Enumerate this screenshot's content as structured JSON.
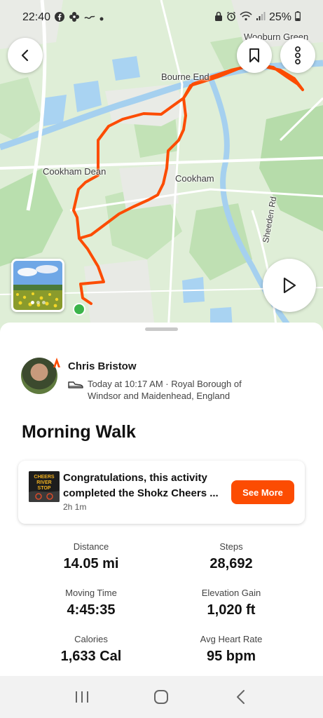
{
  "status_bar": {
    "time": "22:40",
    "battery": "25%",
    "left_icons": [
      "facebook-icon",
      "flower-icon",
      "wave-icon",
      "dot-icon"
    ],
    "right_icons": [
      "lock-icon",
      "alarm-icon",
      "wifi-icon",
      "signal-icon",
      "battery-icon"
    ]
  },
  "map": {
    "places": {
      "wooburn_green": "Wooburn Green",
      "bourne_end": "Bourne End",
      "cookham_dean": "Cookham Dean",
      "cookham": "Cookham",
      "road": "Sheeden Rd"
    },
    "route_color": "#fc4c02",
    "start_color": "#3bb44a"
  },
  "photo": {
    "count": 3,
    "active_index": 0
  },
  "athlete": {
    "name": "Chris Bristow",
    "meta": "Today at 10:17 AM · Royal Borough of Windsor and Maidenhead, England",
    "activity_icon": "shoe-icon"
  },
  "activity": {
    "title": "Morning Walk"
  },
  "challenge": {
    "text": "Congratulations, this activity completed the Shokz Cheers ...",
    "duration": "2h 1m",
    "button": "See More",
    "logo_text_1": "CHEERS",
    "logo_text_2": "RIVER",
    "logo_text_3": "STOP"
  },
  "stats": [
    {
      "label": "Distance",
      "value": "14.05 mi"
    },
    {
      "label": "Steps",
      "value": "28,692"
    },
    {
      "label": "Moving Time",
      "value": "4:45:35"
    },
    {
      "label": "Elevation Gain",
      "value": "1,020 ft"
    },
    {
      "label": "Calories",
      "value": "1,633 Cal"
    },
    {
      "label": "Avg Heart Rate",
      "value": "95 bpm"
    }
  ],
  "colors": {
    "accent": "#fc4c02",
    "nav_bg": "#f2f2f2"
  }
}
